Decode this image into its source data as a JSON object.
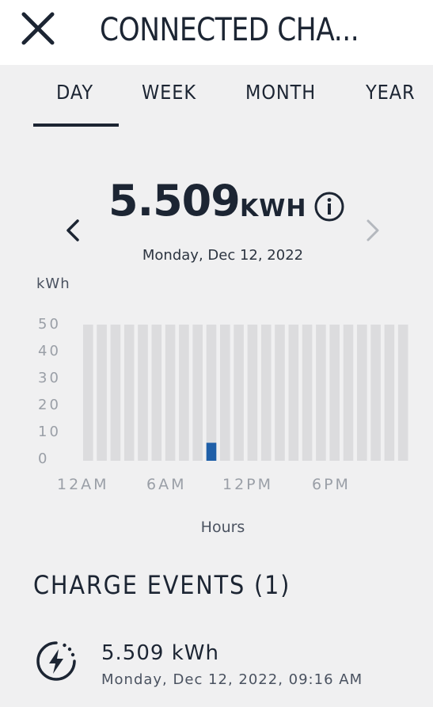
{
  "header": {
    "title": "CONNECTED CHA...",
    "close_icon": "close-icon"
  },
  "tabs": [
    {
      "label": "DAY",
      "selected": true
    },
    {
      "label": "WEEK",
      "selected": false
    },
    {
      "label": "MONTH",
      "selected": false
    },
    {
      "label": "YEAR",
      "selected": false
    }
  ],
  "summary": {
    "value": "5.509",
    "unit": "KWH",
    "date": "Monday, Dec 12, 2022",
    "info_icon": "info-icon",
    "prev_icon": "chevron-left-icon",
    "next_icon": "chevron-right-icon"
  },
  "chart_data": {
    "type": "bar",
    "ylabel": "kWh",
    "xlabel": "Hours",
    "ylim": [
      0,
      50
    ],
    "yticks": [
      "50",
      "40",
      "30",
      "20",
      "10",
      "0"
    ],
    "xtick_labels": [
      "12AM",
      "6AM",
      "12PM",
      "6PM"
    ],
    "categories": [
      "0",
      "1",
      "2",
      "3",
      "4",
      "5",
      "6",
      "7",
      "8",
      "9",
      "10",
      "11",
      "12",
      "13",
      "14",
      "15",
      "16",
      "17",
      "18",
      "19",
      "20",
      "21",
      "22",
      "23"
    ],
    "values": [
      0,
      0,
      0,
      0,
      0,
      0,
      0,
      0,
      0,
      5.509,
      0,
      0,
      0,
      0,
      0,
      0,
      0,
      0,
      0,
      0,
      0,
      0,
      0,
      0
    ],
    "colors": {
      "background_bar": "#dcdcde",
      "value_bar": "#1f5fa8"
    }
  },
  "events": {
    "title": "CHARGE EVENTS (1)",
    "items": [
      {
        "energy": "5.509 kWh",
        "time": "Monday, Dec 12, 2022, 09:16 AM",
        "icon": "charge-bolt-icon"
      }
    ]
  },
  "colors": {
    "accent": "#1c2533",
    "background": "#f0f0f1",
    "header_bg": "#ffffff"
  }
}
